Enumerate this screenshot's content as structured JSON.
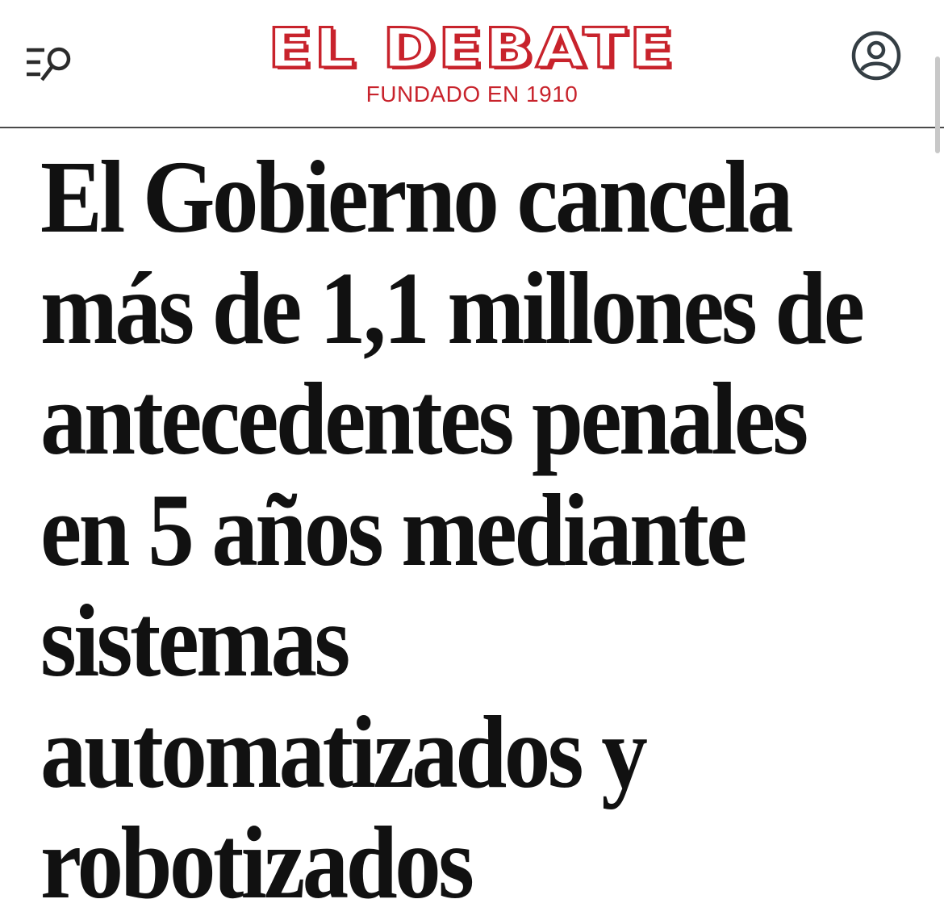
{
  "header": {
    "logo_title": "EL DEBATE",
    "logo_subtitle": "FUNDADO EN 1910",
    "brand_color": "#c8232c",
    "icons": {
      "menu": "menu-search-icon",
      "account": "account-icon"
    }
  },
  "article": {
    "headline_lines": [
      "El Gobierno cancela",
      "más de 1,1 millones de",
      "antecedentes penales",
      "en 5 años mediante",
      "sistemas",
      "automatizados y",
      "robotizados"
    ]
  }
}
